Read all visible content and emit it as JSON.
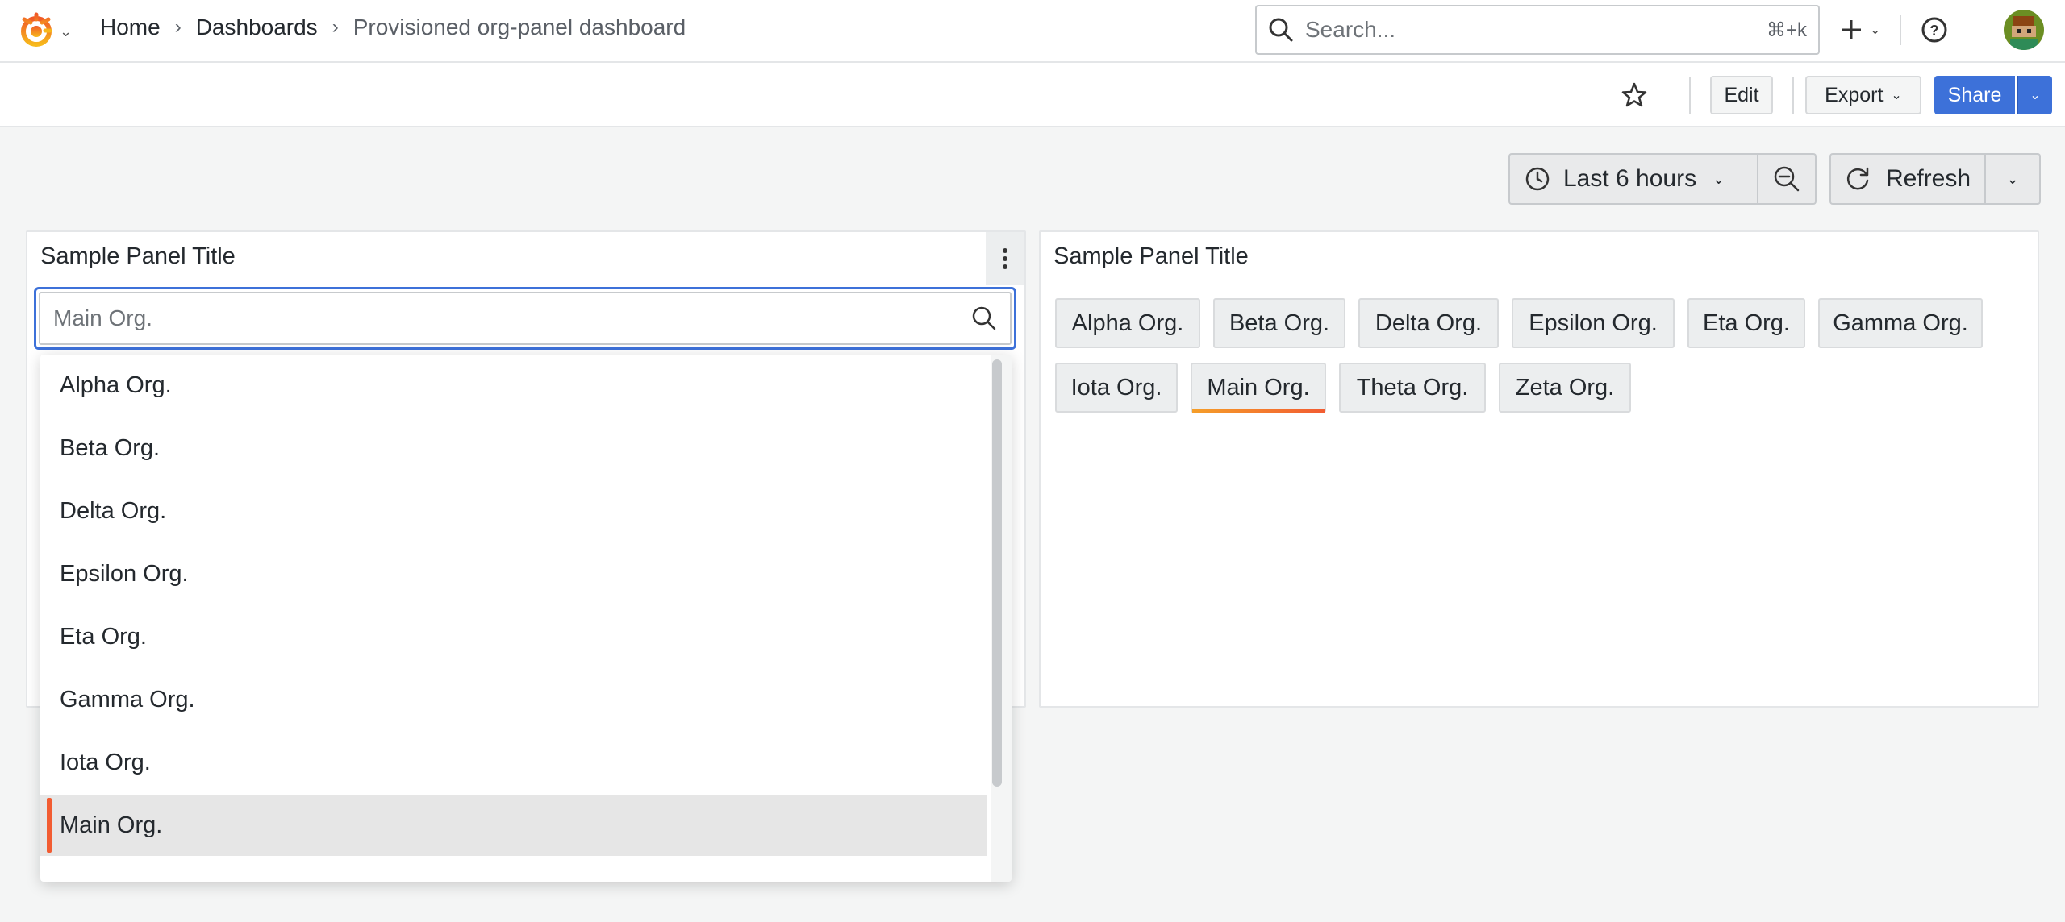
{
  "colors": {
    "accent": "#3d71d9",
    "highlight": "#f25c32"
  },
  "breadcrumb": [
    "Home",
    "Dashboards",
    "Provisioned org-panel dashboard"
  ],
  "search": {
    "placeholder": "Search...",
    "shortcut": "⌘+k"
  },
  "toolbar": {
    "edit": "Edit",
    "export": "Export",
    "share": "Share"
  },
  "time": {
    "range": "Last 6 hours",
    "refresh": "Refresh"
  },
  "panels": [
    {
      "title": "Sample Panel Title",
      "select_placeholder": "Main Org.",
      "options": [
        "Alpha Org.",
        "Beta Org.",
        "Delta Org.",
        "Epsilon Org.",
        "Eta Org.",
        "Gamma Org.",
        "Iota Org.",
        "Main Org."
      ],
      "selected": "Main Org."
    },
    {
      "title": "Sample Panel Title",
      "tags": [
        "Alpha Org.",
        "Beta Org.",
        "Delta Org.",
        "Epsilon Org.",
        "Eta Org.",
        "Gamma Org.",
        "Iota Org.",
        "Main Org.",
        "Theta Org.",
        "Zeta Org."
      ],
      "active": "Main Org."
    }
  ],
  "icons": [
    "grafana-logo-icon",
    "chevron-down-icon",
    "search-icon",
    "plus-icon",
    "help-icon",
    "avatar",
    "star-icon",
    "clock-icon",
    "zoom-out-icon",
    "refresh-icon",
    "kebab-menu-icon"
  ]
}
